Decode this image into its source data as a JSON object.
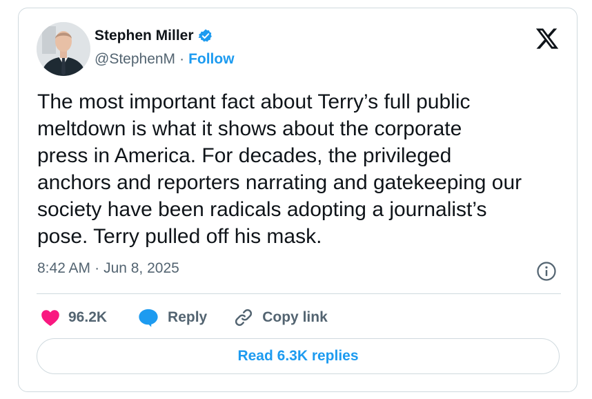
{
  "author": {
    "name": "Stephen Miller",
    "handle": "@StephenM",
    "follow_label": "Follow"
  },
  "tweet": {
    "text": "The most important fact about Terry’s full public\nmeltdown is what it shows about the corporate\npress in America. For decades, the privileged\nanchors and reporters narrating and gatekeeping our\nsociety have been radicals adopting a journalist’s\npose. Terry pulled off his mask.",
    "time": "8:42 AM",
    "date": "Jun 8, 2025"
  },
  "actions": {
    "likes": "96.2K",
    "reply_label": "Reply",
    "copy_label": "Copy link"
  },
  "read_replies_label": "Read 6.3K replies",
  "icons": {
    "verified": "verified-badge-icon",
    "logo": "x-logo-icon",
    "info": "info-icon",
    "like": "heart-icon",
    "reply": "reply-bubble-icon",
    "copy": "link-icon"
  },
  "colors": {
    "accent": "#1d9bf0",
    "like": "#f91880",
    "text": "#0f1419",
    "muted": "#536471",
    "border": "#cfd9de"
  }
}
